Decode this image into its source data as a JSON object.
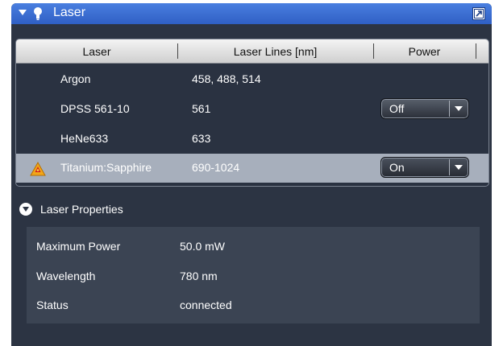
{
  "panel": {
    "title": "Laser"
  },
  "table": {
    "headers": [
      "Laser",
      "Laser Lines [nm]",
      "Power"
    ],
    "rows": [
      {
        "name": "Argon",
        "lines": "458, 488, 514",
        "power": null,
        "warning": false,
        "selected": false
      },
      {
        "name": "DPSS 561-10",
        "lines": "561",
        "power": "Off",
        "warning": false,
        "selected": false
      },
      {
        "name": "HeNe633",
        "lines": "633",
        "power": null,
        "warning": false,
        "selected": false
      },
      {
        "name": "Titanium:Sapphire",
        "lines": "690-1024",
        "power": "On",
        "warning": true,
        "selected": true
      }
    ]
  },
  "laser_properties": {
    "title": "Laser Properties",
    "items": [
      {
        "label": "Maximum Power",
        "value": "50.0 mW"
      },
      {
        "label": "Wavelength",
        "value": "780 nm"
      },
      {
        "label": "Status",
        "value": "connected"
      }
    ]
  },
  "icons": {
    "title_collapse": "chevron-down-icon",
    "title_icon": "laser-bulb-icon",
    "undock": "undock-icon",
    "warning": "laser-warning-icon",
    "dropdown": "chevron-down-icon"
  },
  "colors": {
    "titlebar": "#3a6fd6",
    "panel_bg": "#2c3443",
    "selected_row": "#a7afbc",
    "warning": "#f2a71b"
  }
}
